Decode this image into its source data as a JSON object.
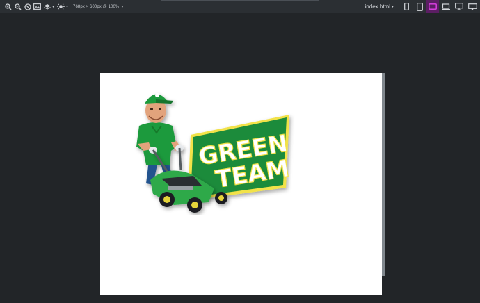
{
  "toolbar": {
    "left_icons": [
      "zoom-in-icon",
      "zoom-out-icon",
      "disable-icon",
      "image-icon",
      "layers-icon",
      "brightness-icon"
    ],
    "viewport_label": "768px × 600px @ 100%",
    "file_label": "index.html",
    "device_icons": [
      "phone-portrait-icon",
      "tablet-portrait-icon",
      "tablet-landscape-icon",
      "laptop-icon",
      "desktop-icon",
      "widescreen-icon"
    ],
    "active_device": "tablet-landscape-icon",
    "colors": {
      "active": "#5b1e63",
      "accent_border": "#d03cd6"
    }
  },
  "preview": {
    "logo": {
      "text_line1": "GREEN",
      "text_line2": "TEAM",
      "colors": {
        "green": "#1f8b3a",
        "yellow": "#f2e24a",
        "white": "#ffffff"
      }
    }
  }
}
